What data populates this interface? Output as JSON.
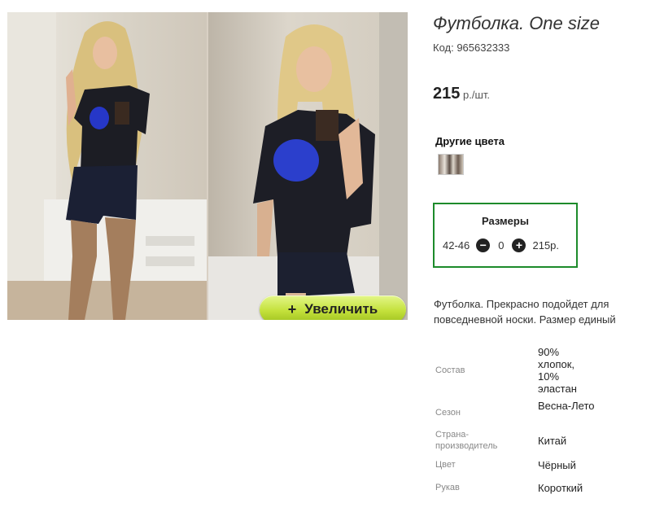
{
  "product": {
    "title": "Футболка. One size",
    "code": "Код: 965632333",
    "price": "215",
    "price_unit": "р./шт.",
    "zoom_button": "Увеличить",
    "zoom_button_icon": "plus-icon"
  },
  "other_colors": {
    "label": "Другие цвета"
  },
  "sizes": {
    "title": "Размеры",
    "rows": [
      {
        "size": "42-46",
        "quantity": "0",
        "price": "215р."
      }
    ]
  },
  "description": "Футболка. Прекрасно подойдет для повседневной носки. Размер единый",
  "specs": [
    {
      "label": "Состав",
      "value": "90% хлопок, 10% эластан"
    },
    {
      "label": "Сезон",
      "value": "Весна-Лето"
    },
    {
      "label": "Страна-производитель",
      "value": "Китай"
    },
    {
      "label": "Цвет",
      "value": "Чёрный"
    },
    {
      "label": "Рукав",
      "value": "Короткий"
    }
  ],
  "colors": {
    "sizes_border": "#1d8b2b",
    "zoom_button": "#c4e13c"
  }
}
